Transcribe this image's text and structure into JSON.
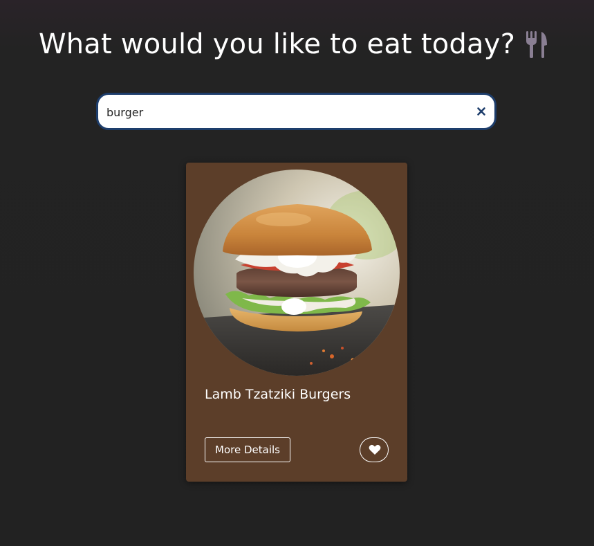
{
  "header": {
    "title": "What would you like to eat today?",
    "title_icon": "utensils-icon"
  },
  "search": {
    "value": "burger",
    "clear_icon": "close-icon",
    "border_color": "#1d3d6b"
  },
  "results": [
    {
      "title": "Lamb Tzatziki Burgers",
      "image": "burger-photo",
      "details_label": "More Details",
      "favorite_icon": "heart-icon",
      "card_color": "#5c3e29"
    }
  ]
}
